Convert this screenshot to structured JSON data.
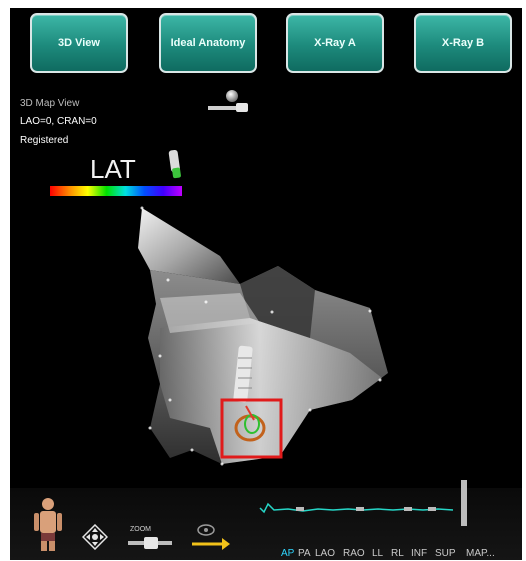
{
  "view_buttons": [
    {
      "label": "3D View"
    },
    {
      "label": "Ideal Anatomy"
    },
    {
      "label": "X-Ray A"
    },
    {
      "label": "X-Ray B"
    }
  ],
  "view_info": {
    "title": "3D Map View",
    "angles": "LAO=0, CRAN=0",
    "status": "Registered"
  },
  "map": {
    "label": "LAT"
  },
  "zoom_label": "ZOOM",
  "projections": [
    {
      "label": "AP",
      "active": true
    },
    {
      "label": "PA",
      "active": false
    },
    {
      "label": "LAO",
      "active": false
    },
    {
      "label": "RAO",
      "active": false
    },
    {
      "label": "LL",
      "active": false
    },
    {
      "label": "RL",
      "active": false
    },
    {
      "label": "INF",
      "active": false
    },
    {
      "label": "SUP",
      "active": false
    },
    {
      "label": "MAP...",
      "active": false
    }
  ],
  "colors": {
    "button": "#1d8a7c",
    "highlight_box": "#e01a1a",
    "active_projection": "#2fd6ff",
    "signal": "#26d6c7"
  }
}
